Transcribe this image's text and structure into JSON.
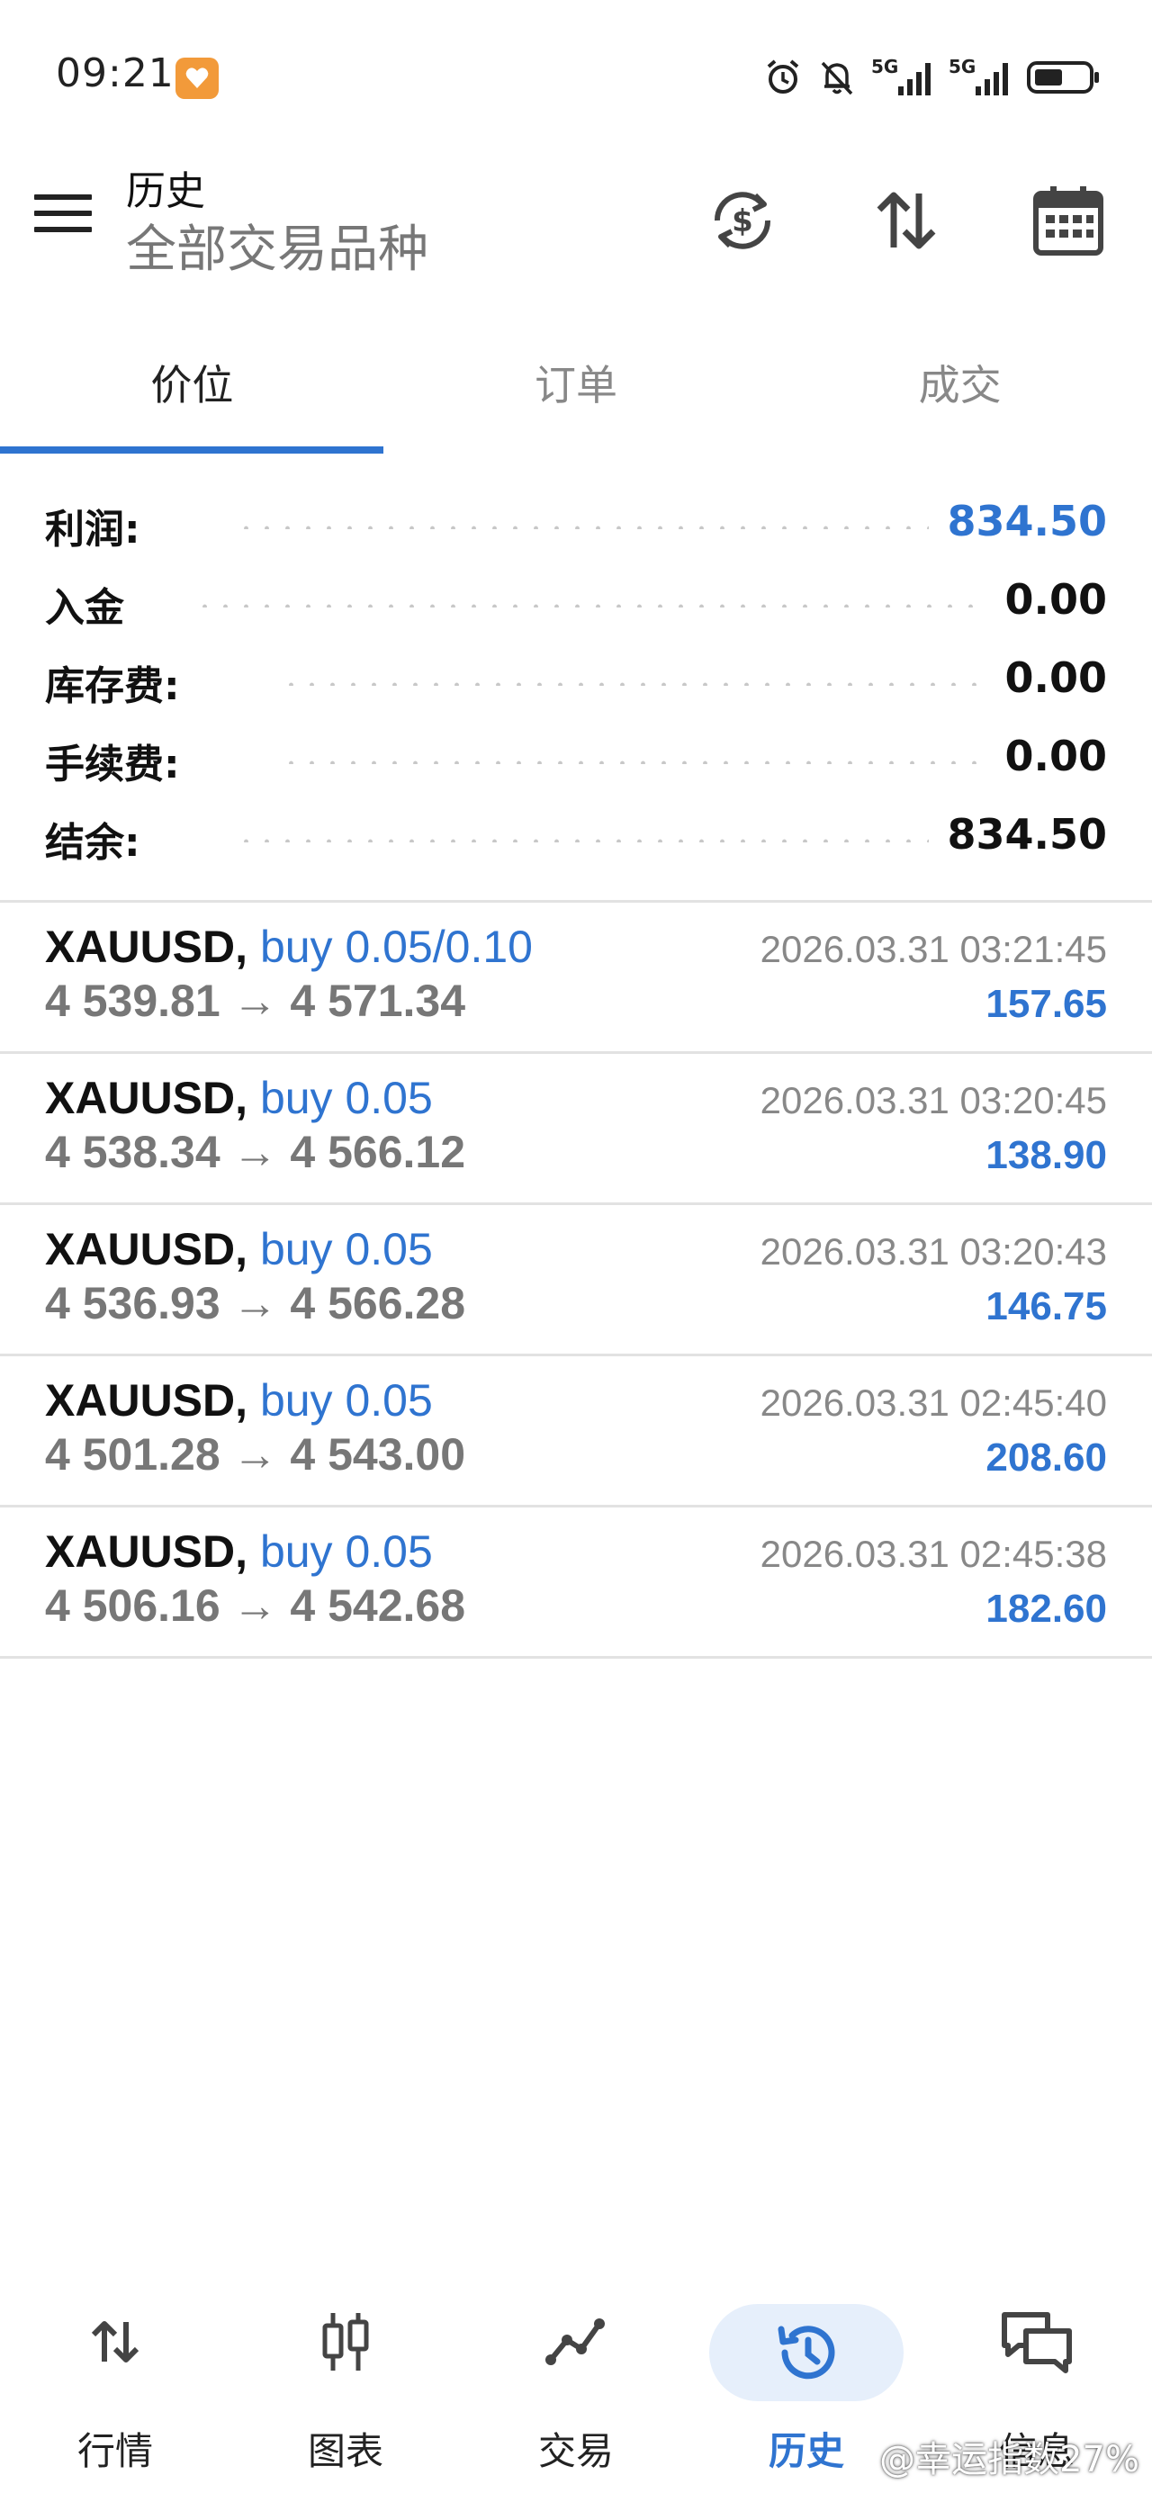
{
  "status_bar": {
    "time": "09:21",
    "network_1": "5G",
    "network_2": "5G"
  },
  "header": {
    "title": "历史",
    "subtitle": "全部交易品种"
  },
  "tabs": [
    {
      "label": "价位",
      "active": true
    },
    {
      "label": "订单",
      "active": false
    },
    {
      "label": "成交",
      "active": false
    }
  ],
  "summary": {
    "profit": {
      "label": "利润:",
      "value": "834.50"
    },
    "deposit": {
      "label": "入金",
      "value": "0.00"
    },
    "swap": {
      "label": "库存费:",
      "value": "0.00"
    },
    "commission": {
      "label": "手续费:",
      "value": "0.00"
    },
    "balance": {
      "label": "结余:",
      "value": "834.50"
    }
  },
  "deals": [
    {
      "symbol": "XAUUSD,",
      "side": "buy 0.05/0.10",
      "prices": "4 539.81 → 4 571.34",
      "time": "2026.03.31 03:21:45",
      "profit": "157.65"
    },
    {
      "symbol": "XAUUSD,",
      "side": "buy 0.05",
      "prices": "4 538.34 → 4 566.12",
      "time": "2026.03.31 03:20:45",
      "profit": "138.90"
    },
    {
      "symbol": "XAUUSD,",
      "side": "buy 0.05",
      "prices": "4 536.93 → 4 566.28",
      "time": "2026.03.31 03:20:43",
      "profit": "146.75"
    },
    {
      "symbol": "XAUUSD,",
      "side": "buy 0.05",
      "prices": "4 501.28 → 4 543.00",
      "time": "2026.03.31 02:45:40",
      "profit": "208.60"
    },
    {
      "symbol": "XAUUSD,",
      "side": "buy 0.05",
      "prices": "4 506.16 → 4 542.68",
      "time": "2026.03.31 02:45:38",
      "profit": "182.60"
    }
  ],
  "bottom_nav": [
    {
      "label": "行情",
      "icon": "quotes-arrows-icon",
      "active": false
    },
    {
      "label": "图表",
      "icon": "chart-candles-icon",
      "active": false
    },
    {
      "label": "交易",
      "icon": "trade-line-icon",
      "active": false
    },
    {
      "label": "历史",
      "icon": "history-clock-icon",
      "active": true
    },
    {
      "label": "信息",
      "icon": "messages-icon",
      "active": false
    }
  ],
  "watermark": "@幸运指数27%",
  "colors": {
    "accent": "#2f74d0",
    "muted_text": "#777777",
    "divider": "#e2e2e2"
  }
}
